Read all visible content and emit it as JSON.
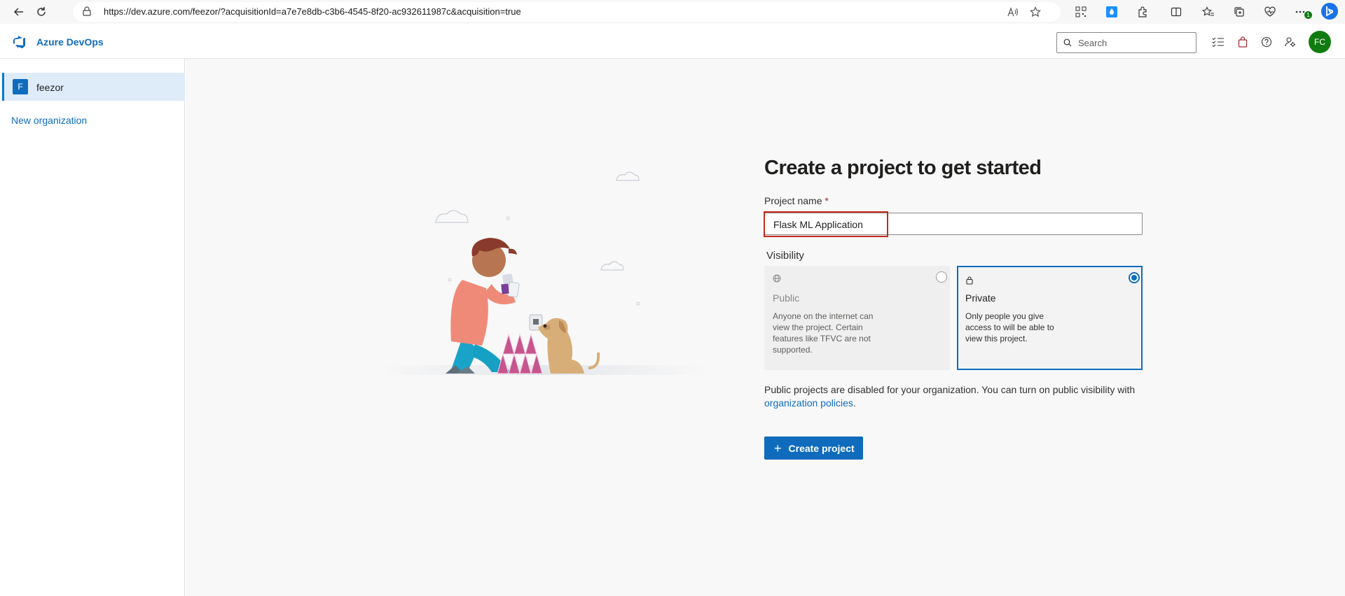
{
  "browser": {
    "url": "https://dev.azure.com/feezor/?acquisitionId=a7e7e8db-c3b6-4545-8f20-ac932611987c&acquisition=true",
    "notification_badge": "1"
  },
  "header": {
    "brand": "Azure DevOps",
    "search_placeholder": "Search",
    "avatar_initials": "FC"
  },
  "sidebar": {
    "org": {
      "badge": "F",
      "label": "feezor"
    },
    "new_org": "New organization"
  },
  "form": {
    "title": "Create a project to get started",
    "project_name_label": "Project name",
    "required_mark": "*",
    "project_name_value": "Flask ML Application",
    "visibility_label": "Visibility",
    "visibility": {
      "selected": "Private",
      "options": [
        {
          "title": "Public",
          "desc": "Anyone on the internet can view the project. Certain features like TFVC are not supported.",
          "icon": "globe-icon",
          "disabled": true
        },
        {
          "title": "Private",
          "desc": "Only people you give access to will be able to view this project.",
          "icon": "lock-icon",
          "disabled": false
        }
      ]
    },
    "notice_text": "Public projects are disabled for your organization. You can turn on public visibility with",
    "notice_link": "organization policies",
    "notice_end": ".",
    "create_button": "Create project"
  },
  "colors": {
    "accent": "#0f6cbd",
    "avatar_bg": "#107c10",
    "highlight": "#c42b1c",
    "main_bg": "#f8f8f8"
  }
}
